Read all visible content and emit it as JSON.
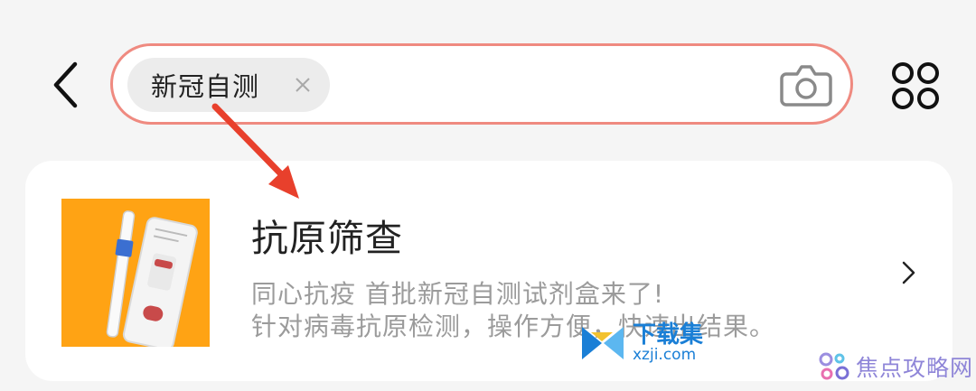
{
  "header": {
    "search_chip": "新冠自测"
  },
  "result_card": {
    "title": "抗原筛查",
    "description_line1": "同心抗疫 首批新冠自测试剂盒来了!",
    "description_line2": "针对病毒抗原检测，操作方便，快速出结果。"
  },
  "watermarks": {
    "site1_name": "下载集",
    "site1_url": "xzji.com",
    "site2_name": "焦点攻略网"
  },
  "colors": {
    "accent_border": "#ef8a80",
    "annotation_arrow": "#e8402c",
    "thumbnail_bg": "#ffa314"
  }
}
